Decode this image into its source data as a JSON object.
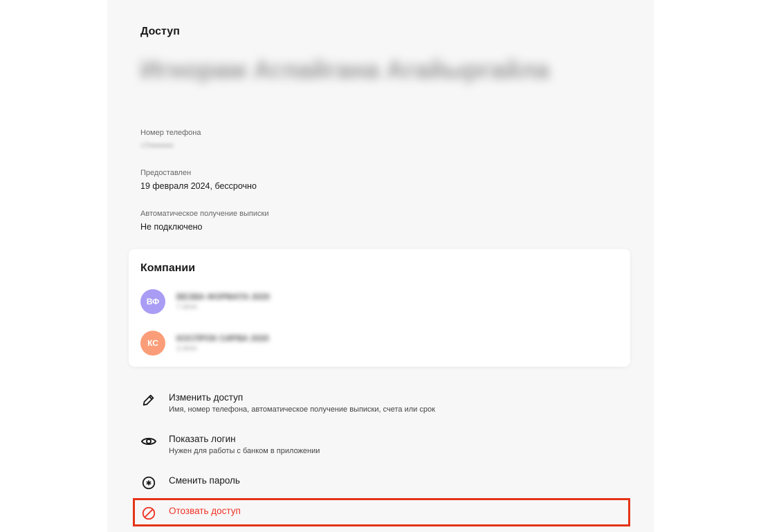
{
  "page": {
    "title": "Доступ",
    "name_hidden": "Игнорам Аглайгана Агайыргайла"
  },
  "fields": [
    {
      "label": "Номер телефона",
      "value": "+7•••••••••"
    },
    {
      "label": "Предоставлен",
      "value": "19 февраля 2024, бессрочно"
    },
    {
      "label": "Автоматическое получение выписки",
      "value": "Не подключено"
    }
  ],
  "companies": {
    "title": "Компании",
    "items": [
      {
        "initials": "ВФ",
        "name": "ВЕЗВА ФОРМАТА 2020",
        "sub": "7 ИНН",
        "color": "#a99cf4"
      },
      {
        "initials": "КС",
        "name": "КОСПРОК СИРВА 2020",
        "sub": "3 ИНН",
        "color": "#fa9d78"
      }
    ]
  },
  "actions": [
    {
      "title": "Изменить доступ",
      "subtitle": "Имя, номер телефона, автоматическое получение выписки, счета или срок",
      "icon": "pencil-icon"
    },
    {
      "title": "Показать логин",
      "subtitle": "Нужен для работы с банком в приложении",
      "icon": "eye-icon"
    },
    {
      "title": "Сменить пароль",
      "subtitle": "",
      "icon": "asterisk-circle-icon"
    },
    {
      "title": "Отозвать доступ",
      "subtitle": "",
      "icon": "prohibited-icon"
    }
  ],
  "colors": {
    "danger": "#ef3124",
    "highlight_border": "#e53418",
    "panel_bg": "#f7f7f7"
  }
}
